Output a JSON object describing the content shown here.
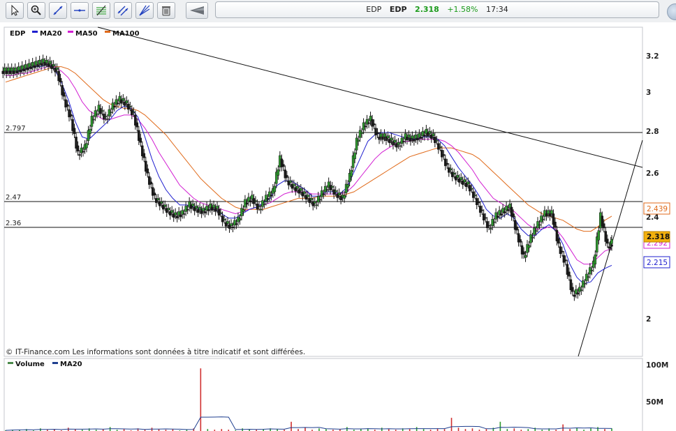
{
  "toolbar": {
    "buttons": [
      "cursor-icon",
      "zoom-icon",
      "trendline-icon",
      "horizontal-line-icon",
      "fibonacci-icon",
      "channel-icon",
      "fan-icon",
      "trash-icon",
      "collapse-icon"
    ]
  },
  "quote": {
    "label": "EDP",
    "symbol": "EDP",
    "price": "2.318",
    "change": "+1.58%",
    "time": "17:34",
    "change_color": "#1a9a1a"
  },
  "legend": {
    "symbol": "EDP",
    "ma20": "MA20",
    "ma50": "MA50",
    "ma100": "MA100",
    "volume": "Volume",
    "vol_ma20": "MA20"
  },
  "colors": {
    "ma20": "#1f1fcf",
    "ma50": "#d21fd2",
    "ma100": "#e06a1a",
    "current": "#f2b00e"
  },
  "levels": {
    "l1": "2.797",
    "l2": "2.47",
    "l3": "2.36"
  },
  "badges": {
    "ma100": "2.439",
    "current": "2.318",
    "ma50": "2.292",
    "ma20": "2.215"
  },
  "copyright": "© IT-Finance.com Les informations sont données à titre indicatif et sont différées.",
  "axis": {
    "price_ticks": [
      "3.2",
      "3",
      "2.8",
      "2.6",
      "2.4",
      "2",
      "2"
    ],
    "volume_ticks": [
      "100M",
      "50M"
    ]
  },
  "chart_data": {
    "type": "line",
    "title": "EDP",
    "ylim": [
      1.8,
      3.3
    ],
    "x": [
      0,
      10,
      20,
      30,
      40,
      50,
      60,
      70,
      80,
      90,
      100,
      110,
      120,
      130,
      140,
      150,
      160,
      170,
      180,
      190,
      200,
      210,
      220,
      230,
      240,
      250,
      260,
      270,
      280,
      290,
      300,
      310,
      320,
      330,
      340,
      350,
      360,
      370,
      380,
      390,
      400,
      410,
      420,
      430,
      440,
      450,
      460,
      470,
      480,
      490,
      500,
      510,
      520,
      530,
      540,
      550,
      560,
      570,
      580,
      590,
      600,
      610,
      620,
      630,
      640,
      650,
      660,
      670,
      680,
      690,
      700,
      710,
      720,
      730,
      740,
      750,
      760,
      770,
      780,
      790,
      800,
      810,
      820,
      830,
      840,
      850,
      860,
      870
    ],
    "series": [
      {
        "name": "EDP",
        "values": [
          3.1,
          3.1,
          3.11,
          3.12,
          3.13,
          3.14,
          3.13,
          3.1,
          2.97,
          2.88,
          2.72,
          2.75,
          2.88,
          2.93,
          2.88,
          2.94,
          2.97,
          2.95,
          2.9,
          2.76,
          2.62,
          2.52,
          2.49,
          2.46,
          2.44,
          2.45,
          2.49,
          2.47,
          2.46,
          2.48,
          2.47,
          2.41,
          2.39,
          2.42,
          2.5,
          2.52,
          2.47,
          2.52,
          2.55,
          2.7,
          2.6,
          2.57,
          2.55,
          2.52,
          2.49,
          2.54,
          2.58,
          2.54,
          2.52,
          2.62,
          2.78,
          2.85,
          2.88,
          2.8,
          2.8,
          2.78,
          2.76,
          2.8,
          2.79,
          2.8,
          2.82,
          2.8,
          2.74,
          2.66,
          2.62,
          2.6,
          2.58,
          2.52,
          2.45,
          2.38,
          2.44,
          2.46,
          2.48,
          2.36,
          2.25,
          2.34,
          2.4,
          2.45,
          2.45,
          2.3,
          2.22,
          2.08,
          2.1,
          2.16,
          2.22,
          2.44,
          2.3,
          2.318
        ]
      },
      {
        "name": "MA20",
        "values": [
          3.1,
          3.1,
          3.1,
          3.11,
          3.12,
          3.12,
          3.13,
          3.11,
          3.05,
          2.97,
          2.87,
          2.8,
          2.79,
          2.82,
          2.85,
          2.88,
          2.92,
          2.94,
          2.93,
          2.89,
          2.8,
          2.7,
          2.62,
          2.56,
          2.52,
          2.49,
          2.49,
          2.48,
          2.47,
          2.47,
          2.47,
          2.45,
          2.43,
          2.43,
          2.45,
          2.47,
          2.48,
          2.5,
          2.52,
          2.58,
          2.6,
          2.6,
          2.58,
          2.56,
          2.53,
          2.53,
          2.55,
          2.55,
          2.54,
          2.57,
          2.64,
          2.71,
          2.78,
          2.81,
          2.82,
          2.82,
          2.81,
          2.8,
          2.79,
          2.79,
          2.8,
          2.8,
          2.79,
          2.76,
          2.71,
          2.66,
          2.62,
          2.58,
          2.53,
          2.47,
          2.44,
          2.43,
          2.45,
          2.43,
          2.38,
          2.35,
          2.35,
          2.38,
          2.4,
          2.37,
          2.31,
          2.22,
          2.16,
          2.13,
          2.14,
          2.18,
          2.2,
          2.215
        ]
      },
      {
        "name": "MA50",
        "values": [
          3.08,
          3.08,
          3.09,
          3.09,
          3.1,
          3.11,
          3.12,
          3.12,
          3.1,
          3.07,
          3.02,
          2.96,
          2.92,
          2.9,
          2.88,
          2.88,
          2.89,
          2.9,
          2.9,
          2.88,
          2.84,
          2.79,
          2.73,
          2.68,
          2.63,
          2.58,
          2.55,
          2.52,
          2.5,
          2.49,
          2.48,
          2.47,
          2.46,
          2.45,
          2.46,
          2.47,
          2.48,
          2.49,
          2.5,
          2.52,
          2.54,
          2.55,
          2.55,
          2.55,
          2.54,
          2.54,
          2.54,
          2.54,
          2.54,
          2.55,
          2.58,
          2.62,
          2.66,
          2.7,
          2.73,
          2.75,
          2.77,
          2.78,
          2.78,
          2.79,
          2.79,
          2.79,
          2.79,
          2.78,
          2.76,
          2.73,
          2.69,
          2.65,
          2.6,
          2.56,
          2.52,
          2.5,
          2.48,
          2.46,
          2.43,
          2.4,
          2.38,
          2.38,
          2.39,
          2.38,
          2.34,
          2.29,
          2.24,
          2.22,
          2.22,
          2.25,
          2.28,
          2.292
        ]
      },
      {
        "name": "MA100",
        "values": [
          3.05,
          3.06,
          3.07,
          3.08,
          3.09,
          3.1,
          3.11,
          3.12,
          3.12,
          3.11,
          3.09,
          3.06,
          3.03,
          3.0,
          2.97,
          2.95,
          2.94,
          2.93,
          2.93,
          2.92,
          2.9,
          2.87,
          2.84,
          2.81,
          2.77,
          2.73,
          2.69,
          2.65,
          2.61,
          2.58,
          2.55,
          2.52,
          2.5,
          2.48,
          2.47,
          2.47,
          2.47,
          2.47,
          2.48,
          2.49,
          2.5,
          2.51,
          2.52,
          2.52,
          2.52,
          2.53,
          2.53,
          2.53,
          2.53,
          2.54,
          2.55,
          2.57,
          2.59,
          2.61,
          2.63,
          2.65,
          2.67,
          2.69,
          2.71,
          2.72,
          2.73,
          2.74,
          2.75,
          2.75,
          2.75,
          2.74,
          2.73,
          2.72,
          2.7,
          2.67,
          2.64,
          2.61,
          2.58,
          2.55,
          2.52,
          2.49,
          2.47,
          2.45,
          2.44,
          2.43,
          2.42,
          2.4,
          2.38,
          2.37,
          2.37,
          2.39,
          2.42,
          2.439
        ]
      }
    ],
    "volume": {
      "name": "Volume",
      "unit": "M",
      "ylim": [
        0,
        110
      ],
      "values": [
        1,
        2,
        2,
        3,
        1,
        4,
        2,
        3,
        1,
        5,
        3,
        2,
        4,
        2,
        3,
        6,
        2,
        3,
        1,
        4,
        2,
        5,
        3,
        2,
        3,
        1,
        2,
        4,
        95,
        3,
        2,
        3,
        2,
        1,
        4,
        3,
        2,
        3,
        4,
        3,
        2,
        14,
        3,
        5,
        2,
        4,
        3,
        2,
        3,
        6,
        2,
        3,
        4,
        2,
        5,
        3,
        2,
        4,
        3,
        6,
        3,
        2,
        4,
        3,
        20,
        5,
        3,
        4,
        2,
        3,
        5,
        14,
        3,
        4,
        2,
        3,
        5,
        2,
        4,
        2,
        10,
        3,
        5,
        2,
        4,
        6,
        3,
        4
      ]
    }
  }
}
